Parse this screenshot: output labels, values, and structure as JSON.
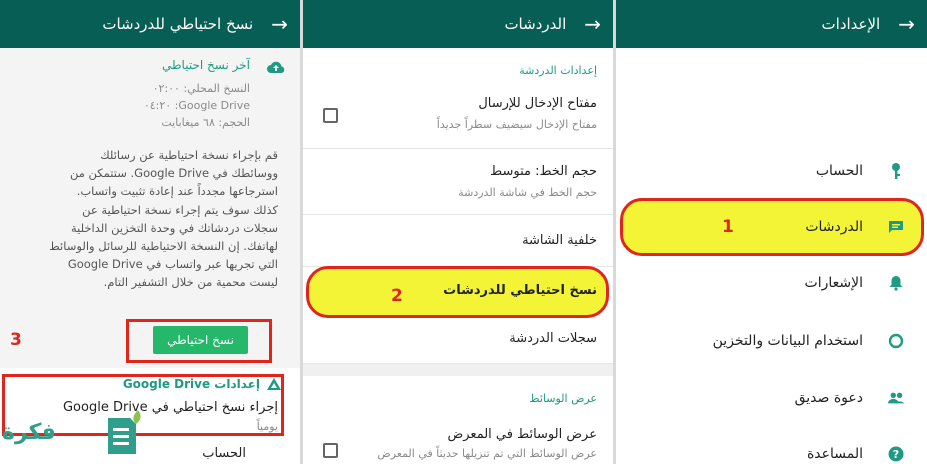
{
  "panel_backup": {
    "title": "نسخ احتياطي للدردشات",
    "last_backup_heading": "آخر نسخ احتياطي",
    "local_line": "النسخ المحلي: ٠٢:٠٠",
    "drive_line": "Google Drive: ٠٤:٢٠",
    "size_line": "الحجم: ٦٨ ميغابايت",
    "description_lines": [
      "قم بإجراء نسخة احتياطية عن رسائلك",
      "ووسائطك في Google Drive. ستتمكن من",
      "استرجاعها مجدداً عند إعادة تثبيت واتساب.",
      "كذلك سوف يتم إجراء نسخة احتياطية عن",
      "سجلات دردشاتك في وحدة التخزين الداخلية",
      "لهاتفك. إن النسخة الاحتياطية للرسائل والوسائط",
      "التي تجريها عبر واتساب في Google Drive",
      "ليست محمية من خلال التشفير التام."
    ],
    "backup_button": "نسخ احتياطي",
    "drive_settings_heading": "إعدادات Google Drive",
    "drive_backup_label": "إجراء نسخ احتياطي في Google Drive",
    "drive_backup_value": "يومياً",
    "account_label": "الحساب"
  },
  "panel_chats": {
    "title": "الدردشات",
    "section_chat_settings": "إعدادات الدردشة",
    "enter_key_title": "مفتاح الإدخال للإرسال",
    "enter_key_sub": "مفتاح الإدخال سيضيف سطراً جديداً",
    "font_size_title": "حجم الخط: متوسط",
    "font_size_sub": "حجم الخط في شاشة الدردشة",
    "wallpaper": "خلفية الشاشة",
    "chat_backup": "نسخ احتياطي للدردشات",
    "chat_history": "سجلات الدردشة",
    "section_media": "عرض الوسائط",
    "media_title": "عرض الوسائط في المعرض",
    "media_sub": "عرض الوسائط التي تم تنزيلها حديثاً في المعرض"
  },
  "panel_settings": {
    "title": "الإعدادات",
    "items": [
      {
        "label": "الحساب",
        "icon": "key-icon"
      },
      {
        "label": "الدردشات",
        "icon": "chat-icon"
      },
      {
        "label": "الإشعارات",
        "icon": "bell-icon"
      },
      {
        "label": "استخدام البيانات والتخزين",
        "icon": "data-usage-icon"
      },
      {
        "label": "دعوة صديق",
        "icon": "people-icon"
      },
      {
        "label": "المساعدة",
        "icon": "help-icon"
      }
    ]
  },
  "annotations": {
    "step1": "1",
    "step2": "2",
    "step3": "3"
  },
  "watermark_text": "فكرة",
  "colors": {
    "header": "#075e54",
    "accent": "#1e9b82",
    "button": "#25b86b",
    "highlight": "#f4f437",
    "annotation": "#e0261c"
  }
}
